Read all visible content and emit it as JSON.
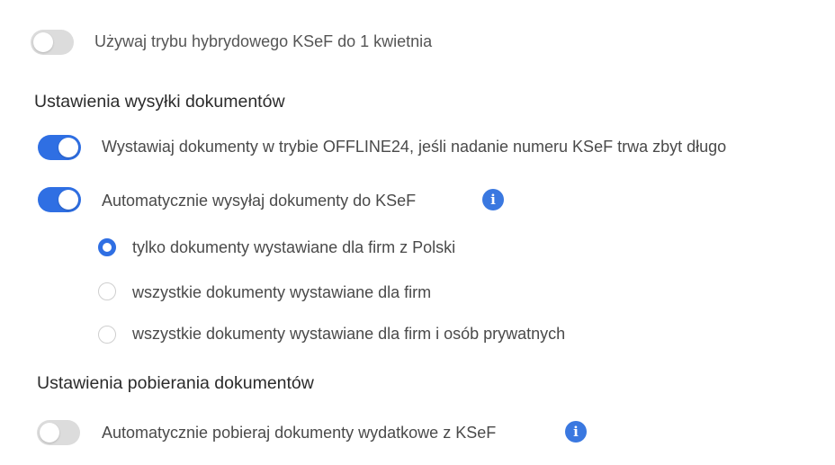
{
  "colors": {
    "accent": "#2f6fe3",
    "toggle_off": "#dcdcdc",
    "text": "#4a4a4a",
    "heading": "#2b2b2b",
    "info": "#3a78e0"
  },
  "hybrid_mode": {
    "enabled": false,
    "label": "Używaj trybu hybrydowego KSeF do 1 kwietnia"
  },
  "sending": {
    "heading": "Ustawienia wysyłki dokumentów",
    "offline24": {
      "enabled": true,
      "label": "Wystawiaj dokumenty w trybie OFFLINE24, jeśli nadanie numeru KSeF trwa zbyt długo"
    },
    "auto_send": {
      "enabled": true,
      "label": "Automatycznie wysyłaj dokumenty do KSeF",
      "info_icon": "info-icon",
      "info_glyph": "i"
    },
    "scope_options": [
      {
        "label": "tylko dokumenty wystawiane dla firm z Polski",
        "checked": true
      },
      {
        "label": "wszystkie dokumenty wystawiane dla firm",
        "checked": false
      },
      {
        "label": "wszystkie dokumenty wystawiane dla firm i osób prywatnych",
        "checked": false
      }
    ]
  },
  "downloading": {
    "heading": "Ustawienia pobierania dokumentów",
    "auto_download": {
      "enabled": false,
      "label": "Automatycznie pobieraj dokumenty wydatkowe z KSeF",
      "info_icon": "info-icon",
      "info_glyph": "i"
    }
  }
}
